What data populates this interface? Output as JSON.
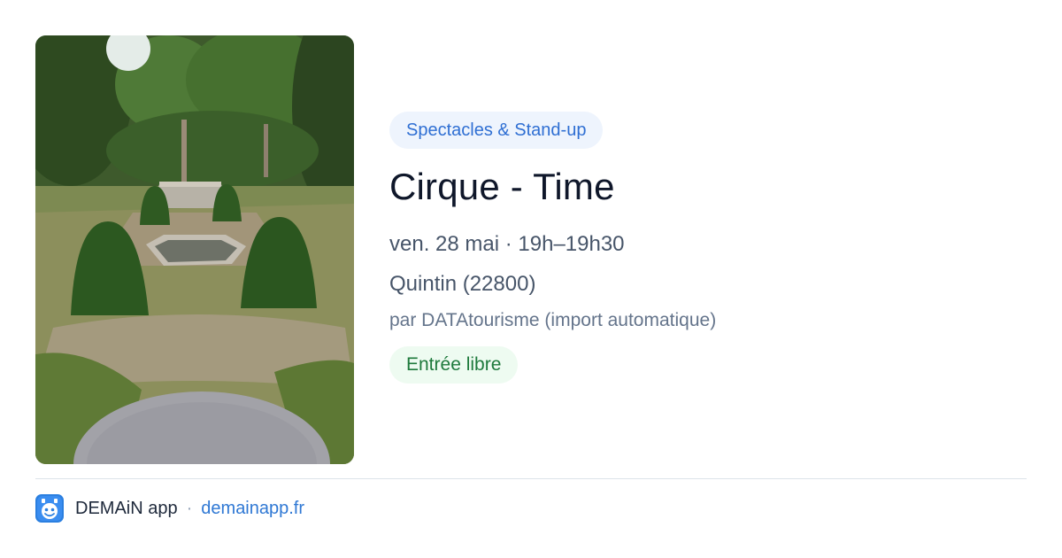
{
  "event": {
    "category": "Spectacles & Stand-up",
    "title": "Cirque - Time",
    "datetime": "ven. 28 mai · 19h–19h30",
    "location": "Quintin (22800)",
    "source": "par DATAtourisme (import automatique)",
    "price": "Entrée libre",
    "image_icon": "garden-photo"
  },
  "footer": {
    "app_name": "DEMAiN app",
    "separator": "·",
    "link": "demainapp.fr",
    "icon": "demain-app-icon"
  },
  "colors": {
    "category_badge_bg": "#eef4fd",
    "category_badge_text": "#2f6fd3",
    "price_badge_bg": "#eefbf1",
    "price_badge_text": "#1e7a3c",
    "link": "#2f78d4",
    "app_icon_bg": "#2b7fe0"
  }
}
